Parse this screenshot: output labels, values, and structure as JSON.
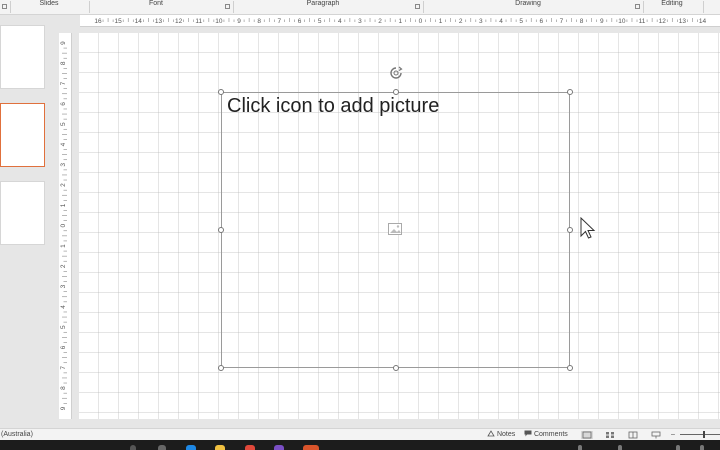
{
  "ribbon": {
    "groups": [
      "Slides",
      "Font",
      "Paragraph",
      "Drawing",
      "Editing"
    ]
  },
  "ruler": {
    "horizontal_ticks": [
      "16",
      "15",
      "14",
      "13",
      "12",
      "11",
      "10",
      "9",
      "8",
      "7",
      "6",
      "5",
      "4",
      "3",
      "2",
      "1",
      "0",
      "1",
      "2",
      "3",
      "4",
      "5",
      "6",
      "7",
      "8",
      "9",
      "10",
      "11",
      "12",
      "13",
      "14"
    ],
    "vertical_ticks": [
      "9",
      "8",
      "7",
      "6",
      "5",
      "4",
      "3",
      "2",
      "1",
      "0",
      "1",
      "2",
      "3",
      "4",
      "5",
      "6",
      "7",
      "8",
      "9"
    ]
  },
  "slide": {
    "placeholder_text": "Click icon to add picture",
    "placeholder_icon": "picture-icon",
    "rotate_icon": "rotate-icon"
  },
  "slides_panel": {
    "thumbnail_count": 3,
    "selected_index": 1
  },
  "status_bar": {
    "language": "(Australia)",
    "notes_label": "Notes",
    "comments_label": "Comments"
  },
  "colors": {
    "selected_thumb": "#e0703c",
    "background": "#e6e6e6"
  }
}
